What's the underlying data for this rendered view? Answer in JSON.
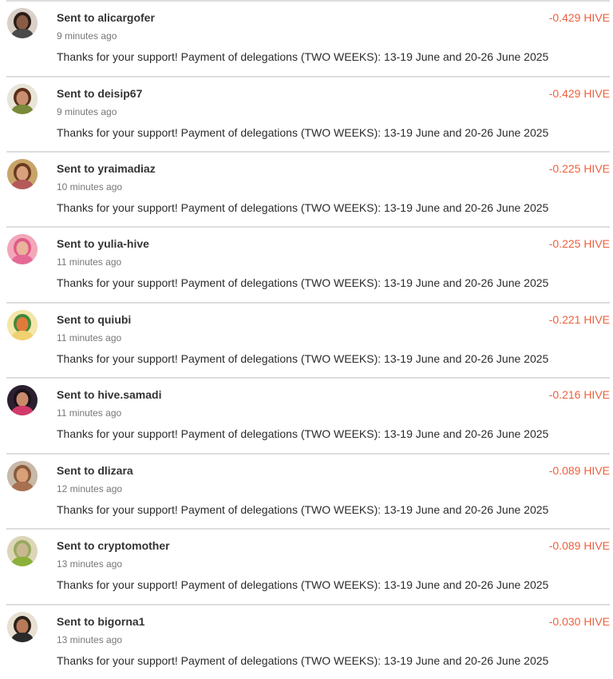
{
  "accent_color": "#ef5f3c",
  "transactions": [
    {
      "title": "Sent to alicargofer",
      "time": "9 minutes ago",
      "amount": "-0.429 HIVE",
      "memo": "Thanks for your support! Payment of delegations (TWO WEEKS): 13-19 June and 20-26 June 2025",
      "avatar_colors": {
        "bg": "#d9d0c8",
        "skin": "#8a5c45",
        "hair": "#2a1d17",
        "shirt": "#4a4a4a"
      }
    },
    {
      "title": "Sent to deisip67",
      "time": "9 minutes ago",
      "amount": "-0.429 HIVE",
      "memo": "Thanks for your support! Payment of delegations (TWO WEEKS): 13-19 June and 20-26 June 2025",
      "avatar_colors": {
        "bg": "#e9e4d8",
        "skin": "#c89070",
        "hair": "#5a2e1a",
        "shirt": "#7a8a3a"
      }
    },
    {
      "title": "Sent to yraimadiaz",
      "time": "10 minutes ago",
      "amount": "-0.225 HIVE",
      "memo": "Thanks for your support! Payment of delegations (TWO WEEKS): 13-19 June and 20-26 June 2025",
      "avatar_colors": {
        "bg": "#c9a46a",
        "skin": "#d8a27e",
        "hair": "#6a3a1e",
        "shirt": "#b55a5a"
      }
    },
    {
      "title": "Sent to yulia-hive",
      "time": "11 minutes ago",
      "amount": "-0.225 HIVE",
      "memo": "Thanks for your support! Payment of delegations (TWO WEEKS): 13-19 June and 20-26 June 2025",
      "avatar_colors": {
        "bg": "#f3a7b8",
        "skin": "#e8b49a",
        "hair": "#e05a8a",
        "shirt": "#e46a95"
      }
    },
    {
      "title": "Sent to quiubi",
      "time": "11 minutes ago",
      "amount": "-0.221 HIVE",
      "memo": "Thanks for your support! Payment of delegations (TWO WEEKS): 13-19 June and 20-26 June 2025",
      "avatar_colors": {
        "bg": "#f4e6a8",
        "skin": "#e07a3a",
        "hair": "#3f8a3a",
        "shirt": "#f0d070"
      }
    },
    {
      "title": "Sent to hive.samadi",
      "time": "11 minutes ago",
      "amount": "-0.216 HIVE",
      "memo": "Thanks for your support! Payment of delegations (TWO WEEKS): 13-19 June and 20-26 June 2025",
      "avatar_colors": {
        "bg": "#2a2030",
        "skin": "#c98a6a",
        "hair": "#1a1218",
        "shirt": "#d23a6a"
      }
    },
    {
      "title": "Sent to dlizara",
      "time": "12 minutes ago",
      "amount": "-0.089 HIVE",
      "memo": "Thanks for your support! Payment of delegations (TWO WEEKS): 13-19 June and 20-26 June 2025",
      "avatar_colors": {
        "bg": "#c8b8a8",
        "skin": "#d8a078",
        "hair": "#8a5a3a",
        "shirt": "#a87050"
      }
    },
    {
      "title": "Sent to cryptomother",
      "time": "13 minutes ago",
      "amount": "-0.089 HIVE",
      "memo": "Thanks for your support! Payment of delegations (TWO WEEKS): 13-19 June and 20-26 June 2025",
      "avatar_colors": {
        "bg": "#dcd6b8",
        "skin": "#c8b890",
        "hair": "#9aa860",
        "shirt": "#8cb03a"
      }
    },
    {
      "title": "Sent to bigorna1",
      "time": "13 minutes ago",
      "amount": "-0.030 HIVE",
      "memo": "Thanks for your support! Payment of delegations (TWO WEEKS): 13-19 June and 20-26 June 2025",
      "avatar_colors": {
        "bg": "#e8e0d0",
        "skin": "#b87a58",
        "hair": "#2a2018",
        "shirt": "#2a2a2a"
      }
    }
  ]
}
